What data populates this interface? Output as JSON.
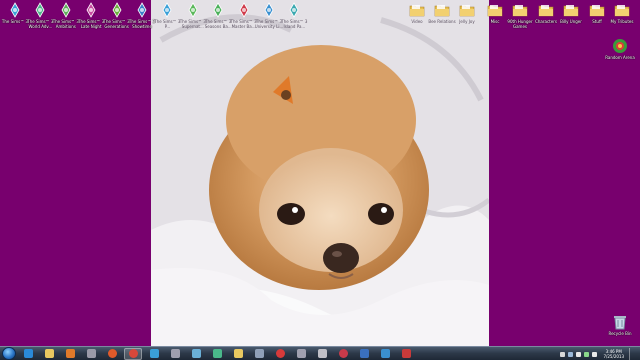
{
  "desktop": {
    "background": "#78006e",
    "left_icons": [
      {
        "label": "The Sims™ 3",
        "icon": "sims3-icon",
        "color": "#3aa0d8"
      },
      {
        "label": "The Sims™ 3 World Adv...",
        "icon": "sims3-world-adventures-icon",
        "color": "#4fb38a"
      },
      {
        "label": "The Sims™ 3 Ambitions",
        "icon": "sims3-ambitions-icon",
        "color": "#5fae5a"
      },
      {
        "label": "The Sims™ 3 Late Night",
        "icon": "sims3-late-night-icon",
        "color": "#c84aa0"
      },
      {
        "label": "The Sims™ 3 Generations",
        "icon": "sims3-generations-icon",
        "color": "#6aae3a"
      },
      {
        "label": "The Sims™ 3 Showtime",
        "icon": "sims3-showtime-icon",
        "color": "#3a80c8"
      },
      {
        "label": "The Sims™ 3 P...",
        "icon": "sims3-pets-icon",
        "color": "#3aa0d8"
      },
      {
        "label": "The Sims™ 3 Supernat...",
        "icon": "sims3-supernatural-icon",
        "color": "#5ab85a"
      },
      {
        "label": "The Sims™ 3 Seasons Ba...",
        "icon": "sims3-seasons-icon",
        "color": "#4ab05a"
      },
      {
        "label": "The Sims™ 3 Master Ba...",
        "icon": "sims3-master-icon",
        "color": "#d03a4a"
      },
      {
        "label": "The Sims™ 3 University Li...",
        "icon": "sims3-university-icon",
        "color": "#3a90d0"
      },
      {
        "label": "The Sims™ 3 Island Pa...",
        "icon": "sims3-island-paradise-icon",
        "color": "#3aa8b0"
      }
    ],
    "right_icons": [
      {
        "label": "Video",
        "icon": "folder-icon"
      },
      {
        "label": "Bee Relations",
        "icon": "folder-icon"
      },
      {
        "label": "Jelly Joy",
        "icon": "folder-icon"
      },
      {
        "label": "Misc",
        "icon": "folder-icon"
      },
      {
        "label": "90th Hunger Games",
        "icon": "folder-icon"
      },
      {
        "label": "Characters",
        "icon": "folder-icon"
      },
      {
        "label": "Billy Unger",
        "icon": "folder-icon"
      },
      {
        "label": "Stuff",
        "icon": "folder-icon"
      },
      {
        "label": "My Tributes",
        "icon": "folder-icon"
      }
    ],
    "random_arena": {
      "label": "Random Arena",
      "icon": "random-arena-icon"
    },
    "recycle_bin": {
      "label": "Recycle Bin",
      "icon": "recycle-bin-icon"
    }
  },
  "taskbar": {
    "pinned": [
      {
        "icon": "internet-explorer-icon",
        "color": "#2a8ad8"
      },
      {
        "icon": "file-explorer-icon",
        "color": "#e8c860"
      },
      {
        "icon": "media-player-icon",
        "color": "#e07a2a"
      },
      {
        "icon": "sims-launcher-icon",
        "color": "#9a9aa8"
      },
      {
        "icon": "firefox-icon",
        "color": "#e05a2a"
      },
      {
        "icon": "chrome-icon",
        "color": "#d8483a"
      },
      {
        "icon": "sims-icon",
        "color": "#3aa0d8"
      },
      {
        "icon": "game-icon",
        "color": "#a0a0b0"
      },
      {
        "icon": "sims-icon",
        "color": "#6ab0d8"
      },
      {
        "icon": "sims-icon",
        "color": "#4ab88a"
      },
      {
        "icon": "folder-icon",
        "color": "#e8c860"
      },
      {
        "icon": "sims-icon",
        "color": "#90a0b8"
      },
      {
        "icon": "blocked-icon",
        "color": "#d83a3a"
      },
      {
        "icon": "tools-icon",
        "color": "#a0a0b0"
      },
      {
        "icon": "sims-icon",
        "color": "#c0c0c8"
      },
      {
        "icon": "record-icon",
        "color": "#c83a4a"
      },
      {
        "icon": "app-icon",
        "color": "#3a70c0"
      },
      {
        "icon": "app-icon",
        "color": "#3a90d0"
      },
      {
        "icon": "app-icon",
        "color": "#c83a3a"
      }
    ],
    "active_index": 5,
    "tray": [
      "flag-icon",
      "network-icon",
      "volume-icon",
      "battery-icon",
      "notification-icon"
    ],
    "time": "3:46 PM",
    "date": "7/25/2013"
  }
}
